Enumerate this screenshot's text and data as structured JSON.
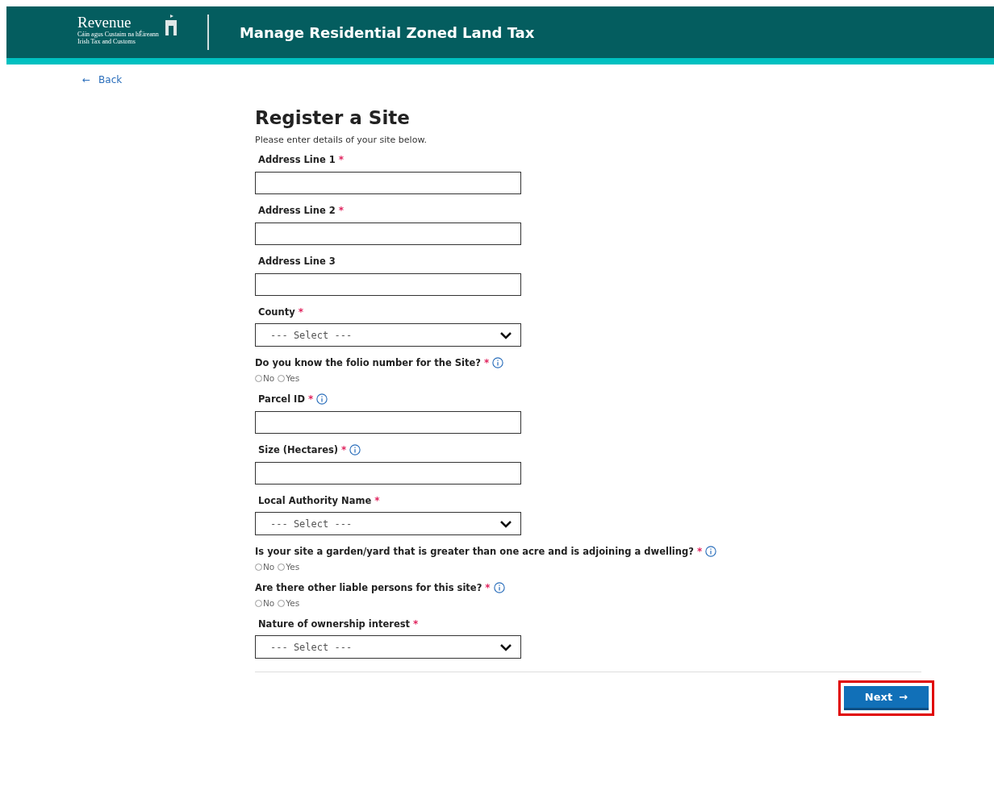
{
  "header": {
    "logo": {
      "name": "Revenue",
      "subtitle_1": "Cáin agus Custaim na hÉireann",
      "subtitle_2": "Irish Tax and Customs"
    },
    "title": "Manage Residential Zoned Land Tax"
  },
  "back_link": {
    "arrow": "←",
    "label": "Back"
  },
  "form": {
    "title": "Register a Site",
    "intro": "Please enter details of your site below.",
    "fields": [
      {
        "kind": "text",
        "label": "Address Line 1",
        "required_mark": "*"
      },
      {
        "kind": "text",
        "label": "Address Line 2",
        "required_mark": "*"
      },
      {
        "kind": "text",
        "label": "Address Line 3"
      },
      {
        "kind": "select",
        "label": "County",
        "required_mark": "*",
        "value": "--- Select ---"
      },
      {
        "kind": "radio",
        "label": "Do you know the folio number for the Site?",
        "required_mark": "*",
        "info": true,
        "options": [
          {
            "label": "No",
            "selected": false
          },
          {
            "label": "Yes",
            "selected": false
          }
        ]
      },
      {
        "kind": "text",
        "label": "Parcel ID",
        "required_mark": "*",
        "info": true
      },
      {
        "kind": "text",
        "label": "Size (Hectares)",
        "required_mark": "*",
        "info": true
      },
      {
        "kind": "select",
        "label": "Local Authority Name",
        "required_mark": "*",
        "value": "--- Select ---"
      },
      {
        "kind": "radio",
        "label": "Is your site a garden/yard that is greater than one acre and is adjoining a dwelling?",
        "required_mark": "*",
        "info": true,
        "options": [
          {
            "label": "No",
            "selected": false
          },
          {
            "label": "Yes",
            "selected": false
          }
        ]
      },
      {
        "kind": "radio",
        "label": "Are there other liable persons for this site?",
        "required_mark": "*",
        "info": true,
        "options": [
          {
            "label": "No",
            "selected": false
          },
          {
            "label": "Yes",
            "selected": false
          }
        ]
      },
      {
        "kind": "select",
        "label": "Nature of ownership interest",
        "required_mark": "*",
        "value": "--- Select ---"
      }
    ],
    "next_button": {
      "label": "Next",
      "arrow": "→",
      "highlighted": true
    }
  }
}
